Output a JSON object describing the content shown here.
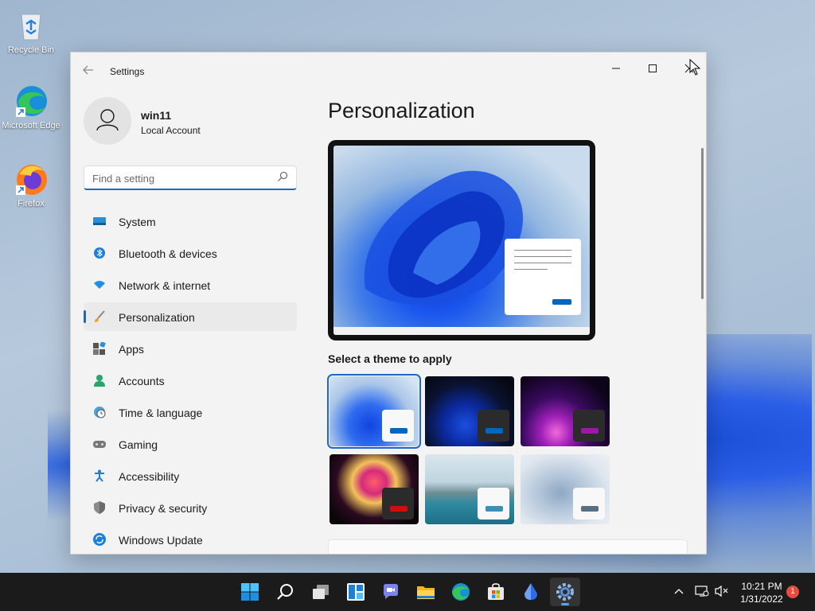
{
  "desktop": {
    "icons": [
      {
        "label": "Recycle Bin"
      },
      {
        "label": "Microsoft Edge"
      },
      {
        "label": "Firefox"
      }
    ]
  },
  "window": {
    "title": "Settings"
  },
  "profile": {
    "name": "win11",
    "account_type": "Local Account"
  },
  "search": {
    "placeholder": "Find a setting",
    "value": ""
  },
  "nav": {
    "items": [
      {
        "label": "System",
        "icon": "system-icon"
      },
      {
        "label": "Bluetooth & devices",
        "icon": "bluetooth-icon"
      },
      {
        "label": "Network & internet",
        "icon": "wifi-icon"
      },
      {
        "label": "Personalization",
        "icon": "paintbrush-icon",
        "selected": true
      },
      {
        "label": "Apps",
        "icon": "apps-icon"
      },
      {
        "label": "Accounts",
        "icon": "person-icon"
      },
      {
        "label": "Time & language",
        "icon": "globe-clock-icon"
      },
      {
        "label": "Gaming",
        "icon": "gamepad-icon"
      },
      {
        "label": "Accessibility",
        "icon": "accessibility-icon"
      },
      {
        "label": "Privacy & security",
        "icon": "shield-icon"
      },
      {
        "label": "Windows Update",
        "icon": "update-icon"
      }
    ]
  },
  "main": {
    "title": "Personalization",
    "theme_section_label": "Select a theme to apply",
    "themes": [
      {
        "name": "windows-light",
        "selected": true,
        "accent": "#0067c0"
      },
      {
        "name": "windows-dark",
        "selected": false,
        "accent": "#0067c0"
      },
      {
        "name": "glow",
        "selected": false,
        "accent": "#9b18a8"
      },
      {
        "name": "captured-motion",
        "selected": false,
        "accent": "#d10d0d"
      },
      {
        "name": "sunrise",
        "selected": false,
        "accent": "#3d8fb3"
      },
      {
        "name": "flow",
        "selected": false,
        "accent": "#5a6f84"
      }
    ]
  },
  "taskbar": {
    "apps": [
      "start-icon",
      "search-icon",
      "task-view-icon",
      "widgets-icon",
      "chat-icon",
      "file-explorer-icon",
      "edge-icon",
      "store-icon",
      "pen-icon",
      "settings-icon"
    ],
    "active_app": "settings-icon",
    "time": "10:21 PM",
    "date": "1/31/2022",
    "notification_count": "1"
  },
  "colors": {
    "accent": "#1e67c4"
  }
}
